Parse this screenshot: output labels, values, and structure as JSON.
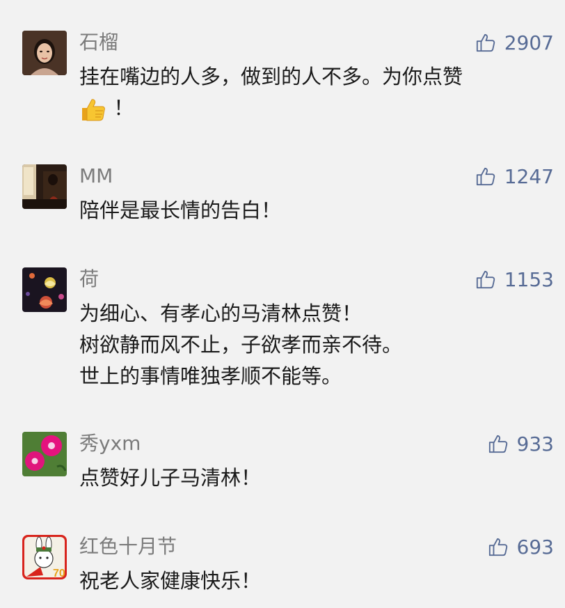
{
  "comments": [
    {
      "name": "石榴",
      "likes": "2907",
      "lines": [
        "挂在嘴边的人多，做到的人不多。为你点赞",
        "！"
      ]
    },
    {
      "name": "MM",
      "likes": "1247",
      "lines": [
        "陪伴是最长情的告白！"
      ]
    },
    {
      "name": "荷",
      "likes": "1153",
      "lines": [
        "为细心、有孝心的马清林点赞！",
        "树欲静而风不止，子欲孝而亲不待。",
        "世上的事情唯独孝顺不能等。"
      ]
    },
    {
      "name": "秀yxm",
      "likes": "933",
      "lines": [
        "点赞好儿子马清林！"
      ]
    },
    {
      "name": "红色十月节",
      "likes": "693",
      "lines": [
        "祝老人家健康快乐！"
      ]
    }
  ],
  "icons": {
    "like": "thumbs-up-outline-icon",
    "emoji": "thumbs-up-emoji"
  },
  "colors": {
    "background": "#f2f2f2",
    "name": "#7b7b7b",
    "likes": "#576b95",
    "text": "#1a1a1a"
  }
}
